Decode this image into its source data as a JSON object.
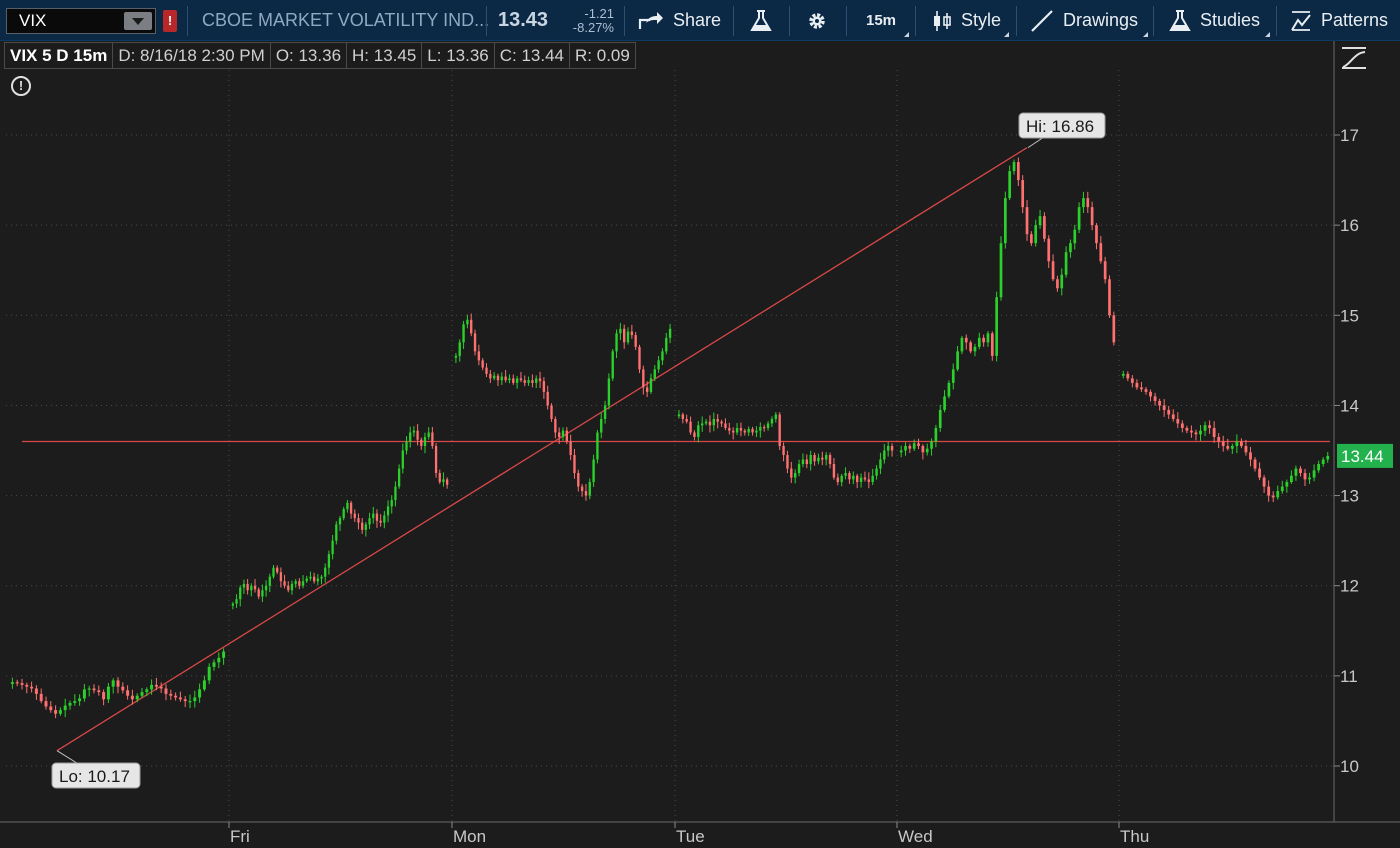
{
  "toolbar": {
    "symbol": "VIX",
    "alert_badge": "!",
    "description": "CBOE MARKET VOLATILITY IND...",
    "last_price": "13.43",
    "net_change": "-1.21",
    "pct_change": "-8.27%",
    "share_label": "Share",
    "interval_label": "15m",
    "style_label": "Style",
    "drawings_label": "Drawings",
    "studies_label": "Studies",
    "patterns_label": "Patterns",
    "icons": [
      "share-icon",
      "flask-icon",
      "gear-icon",
      "candles-icon",
      "pencil-icon",
      "studies-flask-icon",
      "patterns-icon"
    ]
  },
  "infobar": {
    "title": "VIX 5 D 15m",
    "date": "D: 8/16/18 2:30 PM",
    "open": "O: 13.36",
    "high": "H: 13.45",
    "low": "L: 13.36",
    "close": "C: 13.44",
    "range": "R: 0.09"
  },
  "chart_data": {
    "type": "candlestick",
    "symbol": "VIX",
    "interval": "15m",
    "ylim": [
      9.4,
      17.6
    ],
    "y_ticks": [
      10,
      11,
      12,
      13,
      14,
      15,
      16,
      17
    ],
    "x_ticks": [
      "Fri",
      "Mon",
      "Tue",
      "Wed",
      "Thu"
    ],
    "grid": true,
    "last_value_label": "13.44",
    "hi_label": "Hi: 16.86",
    "lo_label": "Lo: 10.17",
    "hi_value": 16.86,
    "lo_value": 10.17,
    "horizontal_line_value": 13.6,
    "trendline": {
      "from": 10.17,
      "to": 16.86
    },
    "colors": {
      "up": "#2bd12b",
      "down": "#ff7070",
      "line": "#d94848",
      "grid": "#4a4a4a",
      "last_badge": "#22b14c"
    },
    "sessions": [
      {
        "close_path": [
          10.93,
          10.92,
          10.9,
          10.88,
          10.86,
          10.8,
          10.72,
          10.66,
          10.62,
          10.58,
          10.62,
          10.67,
          10.7,
          10.72,
          10.75,
          10.85,
          10.86,
          10.84,
          10.82,
          10.74,
          10.88,
          10.95,
          10.88,
          10.84,
          10.78,
          10.74,
          10.78,
          10.82,
          10.85,
          10.9,
          10.88,
          10.86,
          10.8,
          10.78,
          10.76,
          10.74,
          10.72,
          10.72,
          10.76,
          10.85,
          10.95,
          11.1,
          11.15,
          11.2,
          11.27
        ]
      },
      {
        "close_path": [
          11.8,
          11.85,
          11.98,
          12.02,
          11.95,
          12.0,
          11.96,
          11.88,
          11.95,
          12.0,
          12.1,
          12.2,
          12.15,
          12.05,
          12.0,
          11.95,
          12.02,
          12.05,
          12.0,
          12.05,
          12.08,
          12.1,
          12.05,
          12.08,
          12.1,
          12.2,
          12.35,
          12.5,
          12.68,
          12.75,
          12.85,
          12.92,
          12.8,
          12.75,
          12.7,
          12.62,
          12.68,
          12.75,
          12.8,
          12.72,
          12.7,
          12.78,
          12.88,
          12.95,
          13.1,
          13.3,
          13.5,
          13.6,
          13.7,
          13.72,
          13.62,
          13.55,
          13.65,
          13.7,
          13.55,
          13.25,
          13.15,
          13.18,
          13.12
        ]
      },
      {
        "close_path": [
          14.55,
          14.7,
          14.9,
          14.95,
          14.8,
          14.6,
          14.5,
          14.42,
          14.35,
          14.3,
          14.33,
          14.28,
          14.32,
          14.28,
          14.3,
          14.25,
          14.3,
          14.28,
          14.25,
          14.28,
          14.25,
          14.3,
          14.27,
          14.15,
          14.0,
          13.85,
          13.7,
          13.65,
          13.72,
          13.6,
          13.45,
          13.25,
          13.1,
          13.05,
          13.0,
          13.15,
          13.4,
          13.7,
          13.85,
          14.0,
          14.3,
          14.6,
          14.8,
          14.85,
          14.7,
          14.82,
          14.78,
          14.65,
          14.4,
          14.2,
          14.15,
          14.3,
          14.4,
          14.5,
          14.6,
          14.75,
          14.85
        ]
      },
      {
        "close_path": [
          13.9,
          13.85,
          13.82,
          13.7,
          13.65,
          13.78,
          13.8,
          13.82,
          13.78,
          13.85,
          13.82,
          13.8,
          13.75,
          13.72,
          13.7,
          13.75,
          13.72,
          13.7,
          13.74,
          13.7,
          13.72,
          13.76,
          13.75,
          13.8,
          13.85,
          13.9,
          13.55,
          13.45,
          13.3,
          13.2,
          13.25,
          13.35,
          13.4,
          13.35,
          13.45,
          13.38,
          13.42,
          13.4,
          13.45,
          13.35,
          13.2,
          13.15,
          13.22,
          13.25,
          13.18,
          13.22,
          13.15,
          13.2,
          13.18,
          13.15,
          13.22,
          13.3,
          13.4,
          13.5,
          13.55,
          13.5
        ]
      },
      {
        "close_path": [
          13.5,
          13.55,
          13.52,
          13.58,
          13.55,
          13.48,
          13.52,
          13.6,
          13.75,
          13.95,
          14.1,
          14.25,
          14.4,
          14.6,
          14.75,
          14.7,
          14.6,
          14.65,
          14.75,
          14.7,
          14.8,
          14.55,
          15.2,
          15.8,
          16.3,
          16.6,
          16.7,
          16.5,
          16.2,
          15.9,
          15.8,
          16.0,
          16.1,
          15.85,
          15.6,
          15.4,
          15.3,
          15.45,
          15.7,
          15.8,
          15.95,
          16.2,
          16.3,
          16.2,
          16.0,
          15.8,
          15.6,
          15.4,
          15.0,
          14.7
        ]
      },
      {
        "close_path": [
          14.35,
          14.3,
          14.25,
          14.2,
          14.18,
          14.15,
          14.1,
          14.05,
          14.0,
          13.95,
          13.9,
          13.85,
          13.8,
          13.75,
          13.72,
          13.7,
          13.68,
          13.72,
          13.78,
          13.75,
          13.65,
          13.6,
          13.55,
          13.52,
          13.55,
          13.6,
          13.55,
          13.48,
          13.4,
          13.3,
          13.2,
          13.1,
          13.0,
          12.98,
          13.05,
          13.1,
          13.15,
          13.22,
          13.3,
          13.25,
          13.18,
          13.2,
          13.28,
          13.35,
          13.4,
          13.44
        ]
      }
    ]
  }
}
